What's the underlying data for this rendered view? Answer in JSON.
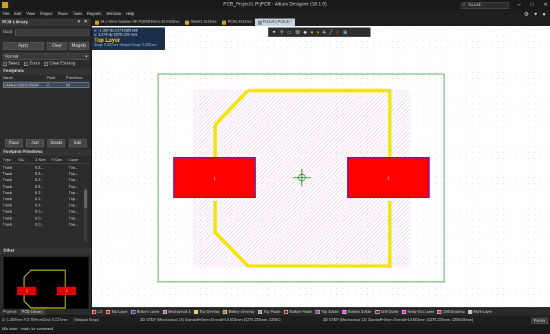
{
  "window": {
    "title": "PCB_Project1.PrjPCB - Altium Designer (18.1.9)",
    "search_placeholder": "Search"
  },
  "menu": [
    "File",
    "Edit",
    "View",
    "Project",
    "Place",
    "Tools",
    "Reports",
    "Window",
    "Help"
  ],
  "panel": {
    "title": "PCB Library",
    "mask_label": "Mask",
    "apply": "Apply",
    "clear": "Clear",
    "magnify": "Magnify",
    "mode": "Normal",
    "checks": [
      "Select",
      "Zoom",
      "Clear Existing"
    ],
    "footprints_header": "Footprints",
    "fp_columns": [
      "Name",
      "Pads",
      "Primitives"
    ],
    "fp_rows": [
      {
        "name": "CAPAE1300X1050M",
        "pads": "2",
        "primitives": "23"
      }
    ],
    "buttons": [
      "Place",
      "Add",
      "Delete",
      "Edit"
    ],
    "primitives_header": "Footprint Primitives",
    "prim_columns": [
      "Type",
      "Na...",
      "X-Size",
      "Y-Size",
      "Layer"
    ],
    "prim_rows": [
      {
        "type": "Track",
        "name": "",
        "x": "0.2...",
        "y": "",
        "layer": "Top..."
      },
      {
        "type": "Track",
        "name": "",
        "x": "0.2...",
        "y": "",
        "layer": "Top..."
      },
      {
        "type": "Track",
        "name": "",
        "x": "0.2...",
        "y": "",
        "layer": "Top..."
      },
      {
        "type": "Track",
        "name": "",
        "x": "0.2...",
        "y": "",
        "layer": "Top..."
      },
      {
        "type": "Track",
        "name": "",
        "x": "0.2...",
        "y": "",
        "layer": "Top..."
      },
      {
        "type": "Track",
        "name": "",
        "x": "0.2...",
        "y": "",
        "layer": "Top..."
      },
      {
        "type": "Track",
        "name": "",
        "x": "0.2...",
        "y": "",
        "layer": "Top..."
      },
      {
        "type": "Track",
        "name": "",
        "x": "0.0...",
        "y": "",
        "layer": "Top..."
      },
      {
        "type": "Track",
        "name": "",
        "x": "0.0...",
        "y": "",
        "layer": "Top..."
      },
      {
        "type": "Track",
        "name": "",
        "x": "0.0...",
        "y": "",
        "layer": "Top..."
      }
    ],
    "other_header": "Other",
    "preview_pads": [
      "1",
      "2"
    ]
  },
  "tabs": [
    {
      "label": "SL1 Xilinx Spartan-IIE PQ208 Rev1.02.PcbDoc",
      "color": "#c9a227",
      "active": false
    },
    {
      "label": "Sheet1.SchDoc",
      "color": "#d9a826",
      "active": false
    },
    {
      "label": "PCB1.PcbDoc",
      "color": "#c9a227",
      "active": false
    },
    {
      "label": "PcbLib1.PcbLib *",
      "color": "#7a8da6",
      "active": true
    }
  ],
  "hud": {
    "line1": "x: -1.397   dx:1273.828  mm",
    "line2": "y:  1.270   dy:1270.120  mm",
    "layer": "Top Layer",
    "snap": "Snap: 0.127mm Hotspot Snap: 0.203mm"
  },
  "pads": [
    "1",
    "2"
  ],
  "layers": [
    {
      "label": "LS",
      "color": "#e00000"
    },
    {
      "label": "Top Layer",
      "color": "#e00000"
    },
    {
      "label": "Bottom Layer",
      "color": "#1a2ad8"
    },
    {
      "label": "Mechanical 1",
      "color": "#d23ad2"
    },
    {
      "label": "Top Overlay",
      "color": "#f2e600"
    },
    {
      "label": "Bottom Overlay",
      "color": "#9c8a00"
    },
    {
      "label": "Top Paste",
      "color": "#888888"
    },
    {
      "label": "Bottom Paste",
      "color": "#800000"
    },
    {
      "label": "Top Solder",
      "color": "#a030a0"
    },
    {
      "label": "Bottom Solder",
      "color": "#ff40ff"
    },
    {
      "label": "Drill Guide",
      "color": "#8b1a1a"
    },
    {
      "label": "Keep-Out Layer",
      "color": "#ff00ff"
    },
    {
      "label": "Drill Drawing",
      "color": "#e02a2a"
    },
    {
      "label": "Multi-Layer",
      "color": "#c0c0c0"
    }
  ],
  "left_tabs": [
    "Projects",
    "PCB Library"
  ],
  "status": {
    "coords": "X:-1.397mm Y:2.794mm",
    "grid": "Grid: 0.127mm",
    "hotspot": "(Hotspot Snap)",
    "step1": "3D STEP  (Mechanical 13)   Standoff=0mm  Overall=10.501mm   (1275.225mm, 1268.0",
    "step2": "3D STEP  (Mechanical 13)   Standoff=0mm  Overall=10.501mm   (1275.225mm, 1268.05mm)",
    "panels": "Panels",
    "idle": "Idle state - ready for command"
  }
}
